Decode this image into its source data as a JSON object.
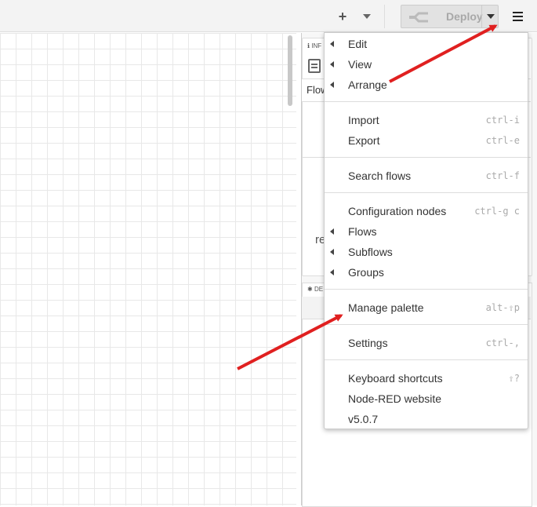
{
  "header": {
    "deploy_label": "Deploy"
  },
  "sidebar": {
    "info_tab": "INF",
    "flow_label": "Flow",
    "partial_text": "re",
    "debug_tab": "DE"
  },
  "menu": {
    "edit": "Edit",
    "view": "View",
    "arrange": "Arrange",
    "import": "Import",
    "import_sc": "ctrl-i",
    "export": "Export",
    "export_sc": "ctrl-e",
    "search": "Search flows",
    "search_sc": "ctrl-f",
    "config": "Configuration nodes",
    "config_sc": "ctrl-g c",
    "flows": "Flows",
    "subflows": "Subflows",
    "groups": "Groups",
    "palette": "Manage palette",
    "palette_sc": "alt-⇧p",
    "settings": "Settings",
    "settings_sc": "ctrl-,",
    "keyboard": "Keyboard shortcuts",
    "keyboard_sc": "⇧?",
    "website": "Node-RED website",
    "version": "v5.0.7"
  },
  "colors": {
    "annotation_arrow": "#e02020"
  }
}
